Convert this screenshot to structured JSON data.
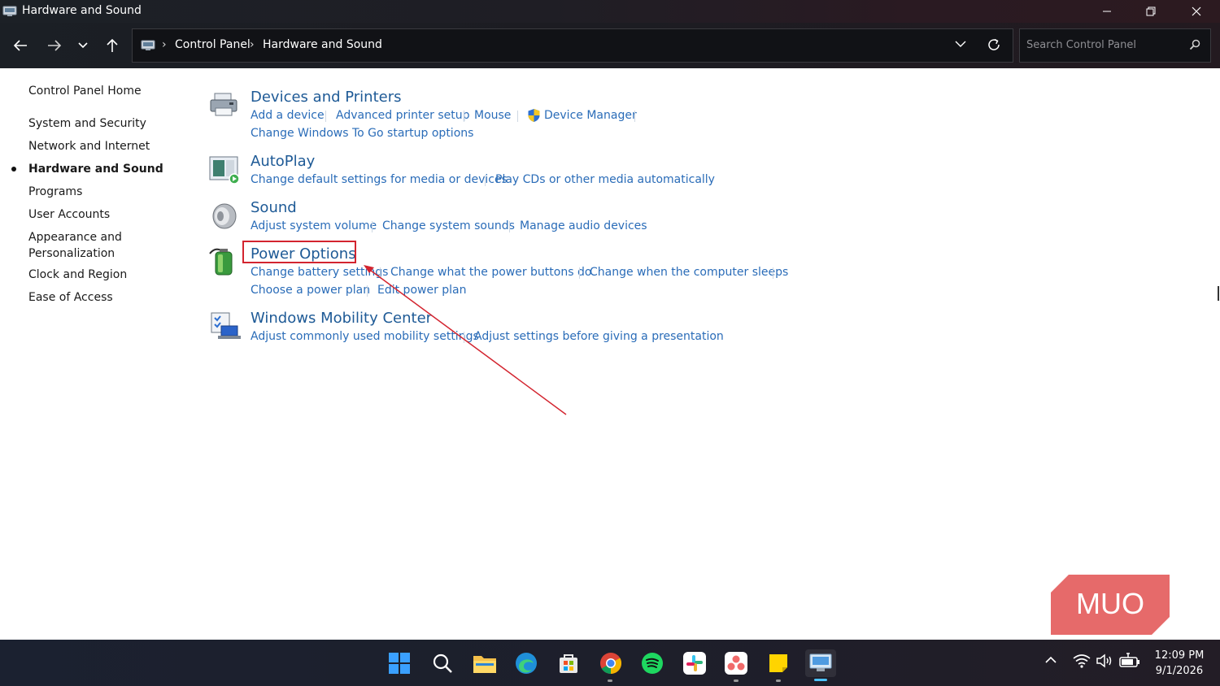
{
  "window": {
    "title": "Hardware and Sound",
    "controls": [
      "minimize-icon",
      "restore-icon",
      "close-icon"
    ]
  },
  "nav": {
    "breadcrumb": [
      "Control Panel",
      "Hardware and Sound"
    ],
    "search_placeholder": "Search Control Panel"
  },
  "sidebar": {
    "items": [
      {
        "label": "Control Panel Home"
      },
      {
        "label": "System and Security"
      },
      {
        "label": "Network and Internet"
      },
      {
        "label": "Hardware and Sound",
        "active": true
      },
      {
        "label": "Programs"
      },
      {
        "label": "User Accounts"
      },
      {
        "label": "Appearance and"
      },
      {
        "label": "Personalization"
      },
      {
        "label": "Clock and Region"
      },
      {
        "label": "Ease of Access"
      }
    ]
  },
  "categories": [
    {
      "title": "Devices and Printers",
      "icon": "printer-icon",
      "tasks": [
        "Add a device",
        "Advanced printer setup",
        "Mouse",
        "Device Manager",
        "Change Windows To Go startup options"
      ]
    },
    {
      "title": "AutoPlay",
      "icon": "autoplay-icon",
      "tasks": [
        "Change default settings for media or devices",
        "Play CDs or other media automatically"
      ]
    },
    {
      "title": "Sound",
      "icon": "speaker-icon",
      "tasks": [
        "Adjust system volume",
        "Change system sounds",
        "Manage audio devices"
      ]
    },
    {
      "title": "Power Options",
      "icon": "battery-icon",
      "tasks": [
        "Change battery settings",
        "Change what the power buttons do",
        "Change when the computer sleeps",
        "Choose a power plan",
        "Edit power plan"
      ]
    },
    {
      "title": "Windows Mobility Center",
      "icon": "mobility-icon",
      "tasks": [
        "Adjust commonly used mobility settings",
        "Adjust settings before giving a presentation"
      ]
    }
  ],
  "taskbar": {
    "apps": [
      "windows-start-icon",
      "search-icon",
      "file-explorer-icon",
      "edge-icon",
      "store-icon",
      "chrome-icon",
      "spotify-icon",
      "slack-icon",
      "asana-icon",
      "sticky-notes-icon",
      "control-panel-icon"
    ],
    "tray": [
      "chevron-up-icon",
      "wifi-icon",
      "volume-icon",
      "battery-icon"
    ],
    "time": "12:09 PM",
    "date": "9/1/2026"
  },
  "watermark": {
    "text": "MUO"
  },
  "colors": {
    "link": "#2a6cb8",
    "category": "#1e5a96",
    "highlight": "#d3242f"
  }
}
